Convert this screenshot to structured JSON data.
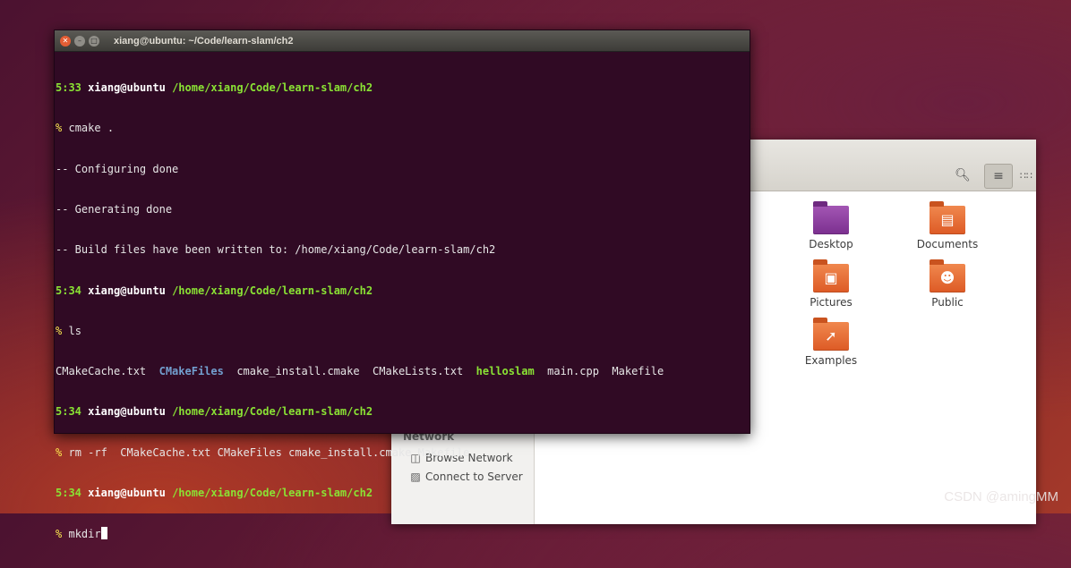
{
  "file_manager": {
    "sidebar_section": "Network",
    "sidebar_items": [
      {
        "label": "Browse Network",
        "icon": "network-icon"
      },
      {
        "label": "Connect to Server",
        "icon": "server-icon"
      }
    ],
    "folders": [
      {
        "label": "Desktop",
        "icon": "desktop-folder-icon"
      },
      {
        "label": "Documents",
        "icon": "documents-folder-icon"
      },
      {
        "label": "Pictures",
        "icon": "pictures-folder-icon"
      },
      {
        "label": "Public",
        "icon": "public-folder-icon"
      },
      {
        "label": "Examples",
        "icon": "examples-folder-icon"
      }
    ]
  },
  "terminal": {
    "title": "xiang@ubuntu: ~/Code/learn-slam/ch2",
    "user": "xiang@ubuntu",
    "path": "/home/xiang/Code/learn-slam/ch2",
    "prompt_symbol": "%",
    "lines": {
      "l1_time": "5:33",
      "l2_cmd": "cmake .",
      "l3": "-- Configuring done",
      "l4": "-- Generating done",
      "l5": "-- Build files have been written to: /home/xiang/Code/learn-slam/ch2",
      "l6_time": "5:34",
      "l7_cmd": "ls",
      "ls_output": [
        "CMakeCache.txt",
        "CMakeFiles",
        "cmake_install.cmake",
        "CMakeLists.txt",
        "helloslam",
        "main.cpp",
        "Makefile"
      ],
      "l9_time": "5:34",
      "l10_cmd": "rm -rf  CMakeCache.txt CMakeFiles cmake_install.cmake Makefile",
      "l11_time": "5:34",
      "l12_cmd": "mkdir"
    }
  },
  "watermark": "CSDN @amingMM"
}
